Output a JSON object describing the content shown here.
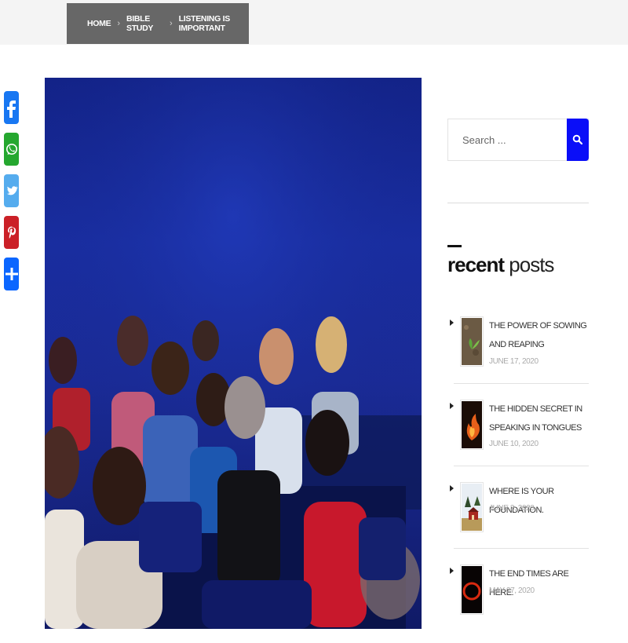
{
  "breadcrumb": {
    "home": "HOME",
    "category": "BIBLE STUDY",
    "current": "LISTENING IS IMPORTANT"
  },
  "share": {
    "icons": [
      "facebook-icon",
      "whatsapp-icon",
      "twitter-icon",
      "pinterest-icon",
      "share-icon"
    ],
    "colors": {
      "facebook": "#1877f2",
      "whatsapp": "#25a72f",
      "twitter": "#55acee",
      "pinterest": "#cb2027",
      "share": "#0b66ff"
    }
  },
  "search": {
    "placeholder": "Search ...",
    "button_icon": "search-icon",
    "accent": "#0a0ef8"
  },
  "widget": {
    "title_bold": "recent",
    "title_light": " posts"
  },
  "posts": [
    {
      "title": "THE POWER OF SOWING AND REAPING",
      "date": "JUNE 17, 2020"
    },
    {
      "title": "THE HIDDEN SECRET IN SPEAKING IN TONGUES",
      "date": "JUNE 10, 2020"
    },
    {
      "title": "WHERE IS YOUR FOUNDATION.",
      "date": "JUNE 3, 2020"
    },
    {
      "title": "THE END TIMES ARE HERE.",
      "date": "MAY 27, 2020"
    }
  ]
}
